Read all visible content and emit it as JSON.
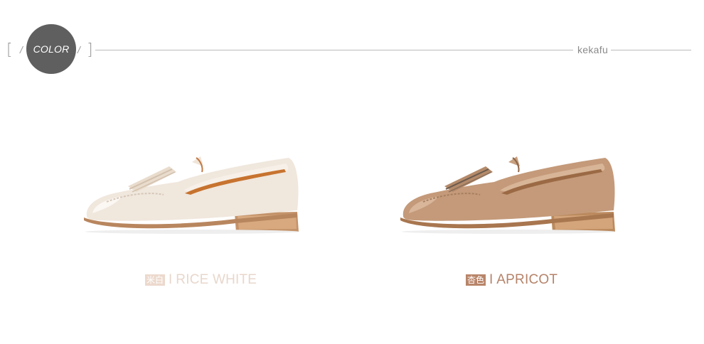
{
  "header": {
    "badge_label": "COLOR",
    "brand": "kekafu",
    "bracket_open": "[",
    "bracket_close": "]",
    "slash": "/"
  },
  "products": [
    {
      "chip_label": "米白",
      "separator": "I",
      "color_name": "RICE WHITE",
      "shoe_icon": "loafer-shoe-icon",
      "upper_color": "#f0e7dd",
      "sole_color": "#b8865e"
    },
    {
      "chip_label": "杏色",
      "separator": "I",
      "color_name": "APRICOT",
      "shoe_icon": "loafer-shoe-icon",
      "upper_color": "#c49a7a",
      "sole_color": "#b88a5e"
    }
  ]
}
